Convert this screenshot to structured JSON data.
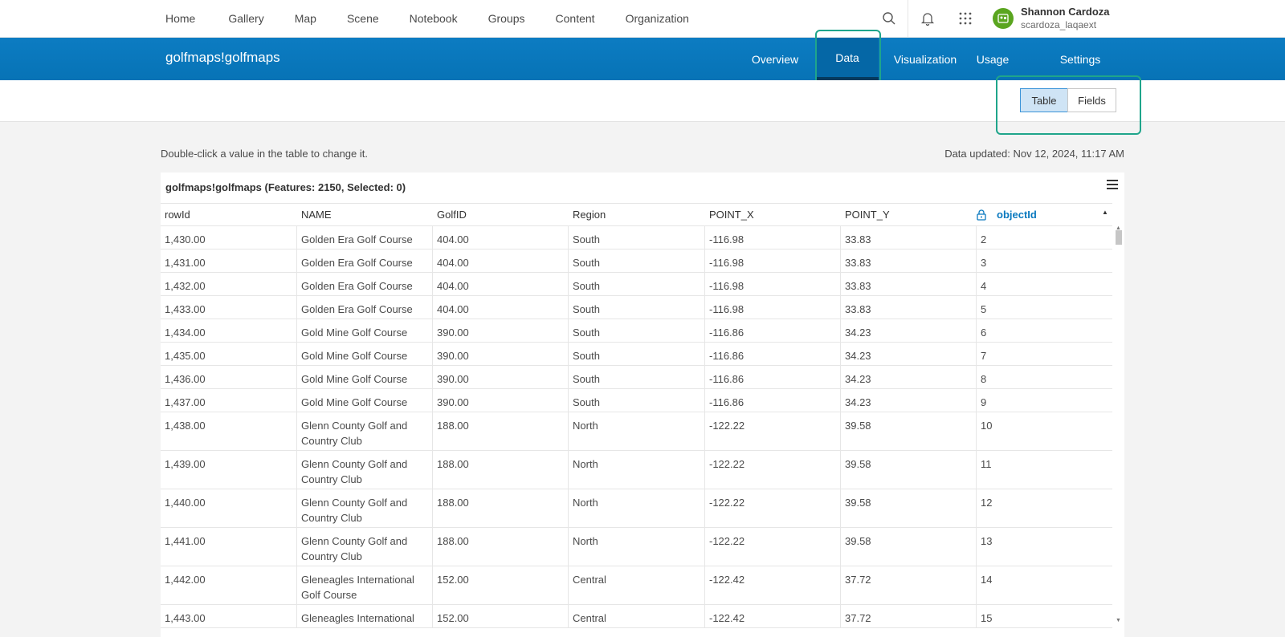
{
  "nav": {
    "links": [
      "Home",
      "Gallery",
      "Map",
      "Scene",
      "Notebook",
      "Groups",
      "Content",
      "Organization"
    ],
    "user_name": "Shannon Cardoza",
    "user_id": "scardoza_laqaext"
  },
  "item": {
    "title": "golfmaps!golfmaps",
    "tabs": [
      "Overview",
      "Data",
      "Visualization",
      "Usage",
      "Settings"
    ],
    "active_tab": "Data"
  },
  "view_toggle": {
    "table": "Table",
    "fields": "Fields",
    "selected": "Table"
  },
  "hint": "Double-click a value in the table to change it.",
  "updated": "Data updated: Nov 12, 2024, 11:17 AM",
  "table": {
    "title": "golfmaps!golfmaps (Features: 2150, Selected: 0)",
    "columns": [
      "rowId",
      "NAME",
      "GolfID",
      "Region",
      "POINT_X",
      "POINT_Y",
      "objectId"
    ],
    "sorted_column": "objectId",
    "rows": [
      [
        "1,430.00",
        "Golden Era Golf Course",
        "404.00",
        "South",
        "-116.98",
        "33.83",
        "2"
      ],
      [
        "1,431.00",
        "Golden Era Golf Course",
        "404.00",
        "South",
        "-116.98",
        "33.83",
        "3"
      ],
      [
        "1,432.00",
        "Golden Era Golf Course",
        "404.00",
        "South",
        "-116.98",
        "33.83",
        "4"
      ],
      [
        "1,433.00",
        "Golden Era Golf Course",
        "404.00",
        "South",
        "-116.98",
        "33.83",
        "5"
      ],
      [
        "1,434.00",
        "Gold Mine Golf Course",
        "390.00",
        "South",
        "-116.86",
        "34.23",
        "6"
      ],
      [
        "1,435.00",
        "Gold Mine Golf Course",
        "390.00",
        "South",
        "-116.86",
        "34.23",
        "7"
      ],
      [
        "1,436.00",
        "Gold Mine Golf Course",
        "390.00",
        "South",
        "-116.86",
        "34.23",
        "8"
      ],
      [
        "1,437.00",
        "Gold Mine Golf Course",
        "390.00",
        "South",
        "-116.86",
        "34.23",
        "9"
      ],
      [
        "1,438.00",
        "Glenn County Golf and Country Club",
        "188.00",
        "North",
        "-122.22",
        "39.58",
        "10"
      ],
      [
        "1,439.00",
        "Glenn County Golf and Country Club",
        "188.00",
        "North",
        "-122.22",
        "39.58",
        "11"
      ],
      [
        "1,440.00",
        "Glenn County Golf and Country Club",
        "188.00",
        "North",
        "-122.22",
        "39.58",
        "12"
      ],
      [
        "1,441.00",
        "Glenn County Golf and Country Club",
        "188.00",
        "North",
        "-122.22",
        "39.58",
        "13"
      ],
      [
        "1,442.00",
        "Gleneagles International Golf Course",
        "152.00",
        "Central",
        "-122.42",
        "37.72",
        "14"
      ],
      [
        "1,443.00",
        "Gleneagles International",
        "152.00",
        "Central",
        "-122.42",
        "37.72",
        "15"
      ]
    ]
  },
  "colors": {
    "brand_blue": "#0a79bf",
    "highlight": "#1fa58b",
    "user_avatar": "#5aa51f"
  }
}
